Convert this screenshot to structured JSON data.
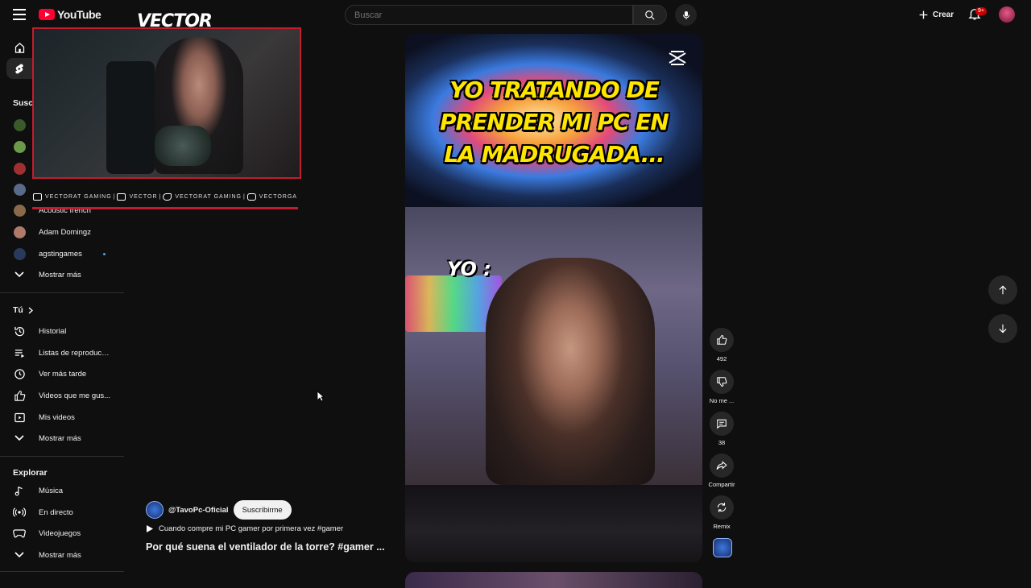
{
  "header": {
    "logo_text": "YouTube",
    "search_placeholder": "Buscar",
    "create_label": "Crear",
    "notifications_badge": "9+"
  },
  "sidebar": {
    "subscriptions_heading": "Susc",
    "channels": [
      {
        "label": "Acoustic french",
        "color": "#8a6a4a"
      },
      {
        "label": "Adam Domingz",
        "color": "#b07a6a"
      },
      {
        "label": "agstingames",
        "color": "#2a3a5a"
      }
    ],
    "more_subs": "Mostrar más",
    "you_heading": "Tú",
    "you_items": [
      {
        "icon": "history-icon",
        "label": "Historial"
      },
      {
        "icon": "playlists-icon",
        "label": "Listas de reproducc..."
      },
      {
        "icon": "watch-later-icon",
        "label": "Ver más tarde"
      },
      {
        "icon": "liked-icon",
        "label": "Videos que me gus..."
      },
      {
        "icon": "your-videos-icon",
        "label": "Mis videos"
      }
    ],
    "more_you": "Mostrar más",
    "explore_heading": "Explorar",
    "explore_items": [
      {
        "icon": "music-icon",
        "label": "Música"
      },
      {
        "icon": "live-icon",
        "label": "En directo"
      },
      {
        "icon": "gaming-icon",
        "label": "Videojuegos"
      }
    ],
    "more_explore": "Mostrar más"
  },
  "overlay": {
    "brand": "VECTOR",
    "social": [
      "VECTORAT GAMING",
      "VECTOR",
      "VECTORAT GAMING",
      "VECTORGA"
    ]
  },
  "short": {
    "caption": "YO TRATANDO DE PRENDER MI PC EN LA MADRUGADA...",
    "yo_label": "YO :",
    "channel": "@TavoPc-Oficial",
    "subscribe": "Suscribirme",
    "music": "Cuando compre mi PC gamer por primera vez #gamer",
    "title": "Por qué suena el ventilador de la torre? #gamer ..."
  },
  "actions": {
    "likes": "492",
    "dislike": "No me ...",
    "comments": "38",
    "share": "Compartir",
    "remix": "Remix"
  }
}
